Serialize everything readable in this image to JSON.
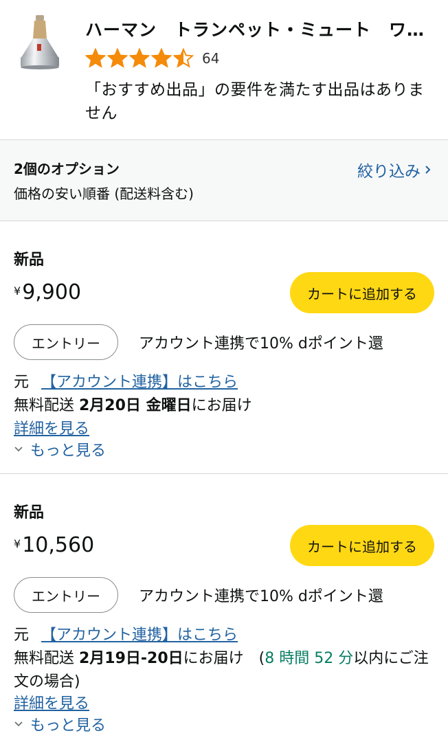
{
  "product": {
    "title": "ハーマン　トランペット・ミュート　ワ…",
    "rating": 4.5,
    "review_count": "64",
    "notice": "「おすすめ出品」の要件を満たす出品はありません"
  },
  "options": {
    "count_label": "2個のオプション",
    "sort_label": "価格の安い順番 (配送料含む)",
    "filter_label": "絞り込み"
  },
  "offers": [
    {
      "condition": "新品",
      "price_symbol": "¥",
      "price": "9,900",
      "cart_label": "カートに追加する",
      "entry_label": "エントリー",
      "promo_text": "アカウント連携で10% dポイント還",
      "promo_text_cont": "元",
      "promo_link": "【アカウント連携】はこちら",
      "delivery_prefix": "無料配送 ",
      "delivery_date": "2月20日 金曜日",
      "delivery_suffix": "にお届け",
      "details_label": "詳細を見る",
      "more_label": "もっと見る"
    },
    {
      "condition": "新品",
      "price_symbol": "¥",
      "price": "10,560",
      "cart_label": "カートに追加する",
      "entry_label": "エントリー",
      "promo_text": "アカウント連携で10% dポイント還",
      "promo_text_cont": "元",
      "promo_link": "【アカウント連携】はこちら",
      "delivery_prefix": "無料配送 ",
      "delivery_date": "2月19日-20日",
      "delivery_suffix": "にお届け　(",
      "countdown": "8 時間 52 分",
      "delivery_tail": "以内にご注文の場合)",
      "details_label": "詳細を見る",
      "more_label": "もっと見る"
    }
  ],
  "colors": {
    "link": "#2162a1",
    "cart_button": "#ffd814",
    "star": "#f48b0a",
    "countdown": "#067d62"
  }
}
